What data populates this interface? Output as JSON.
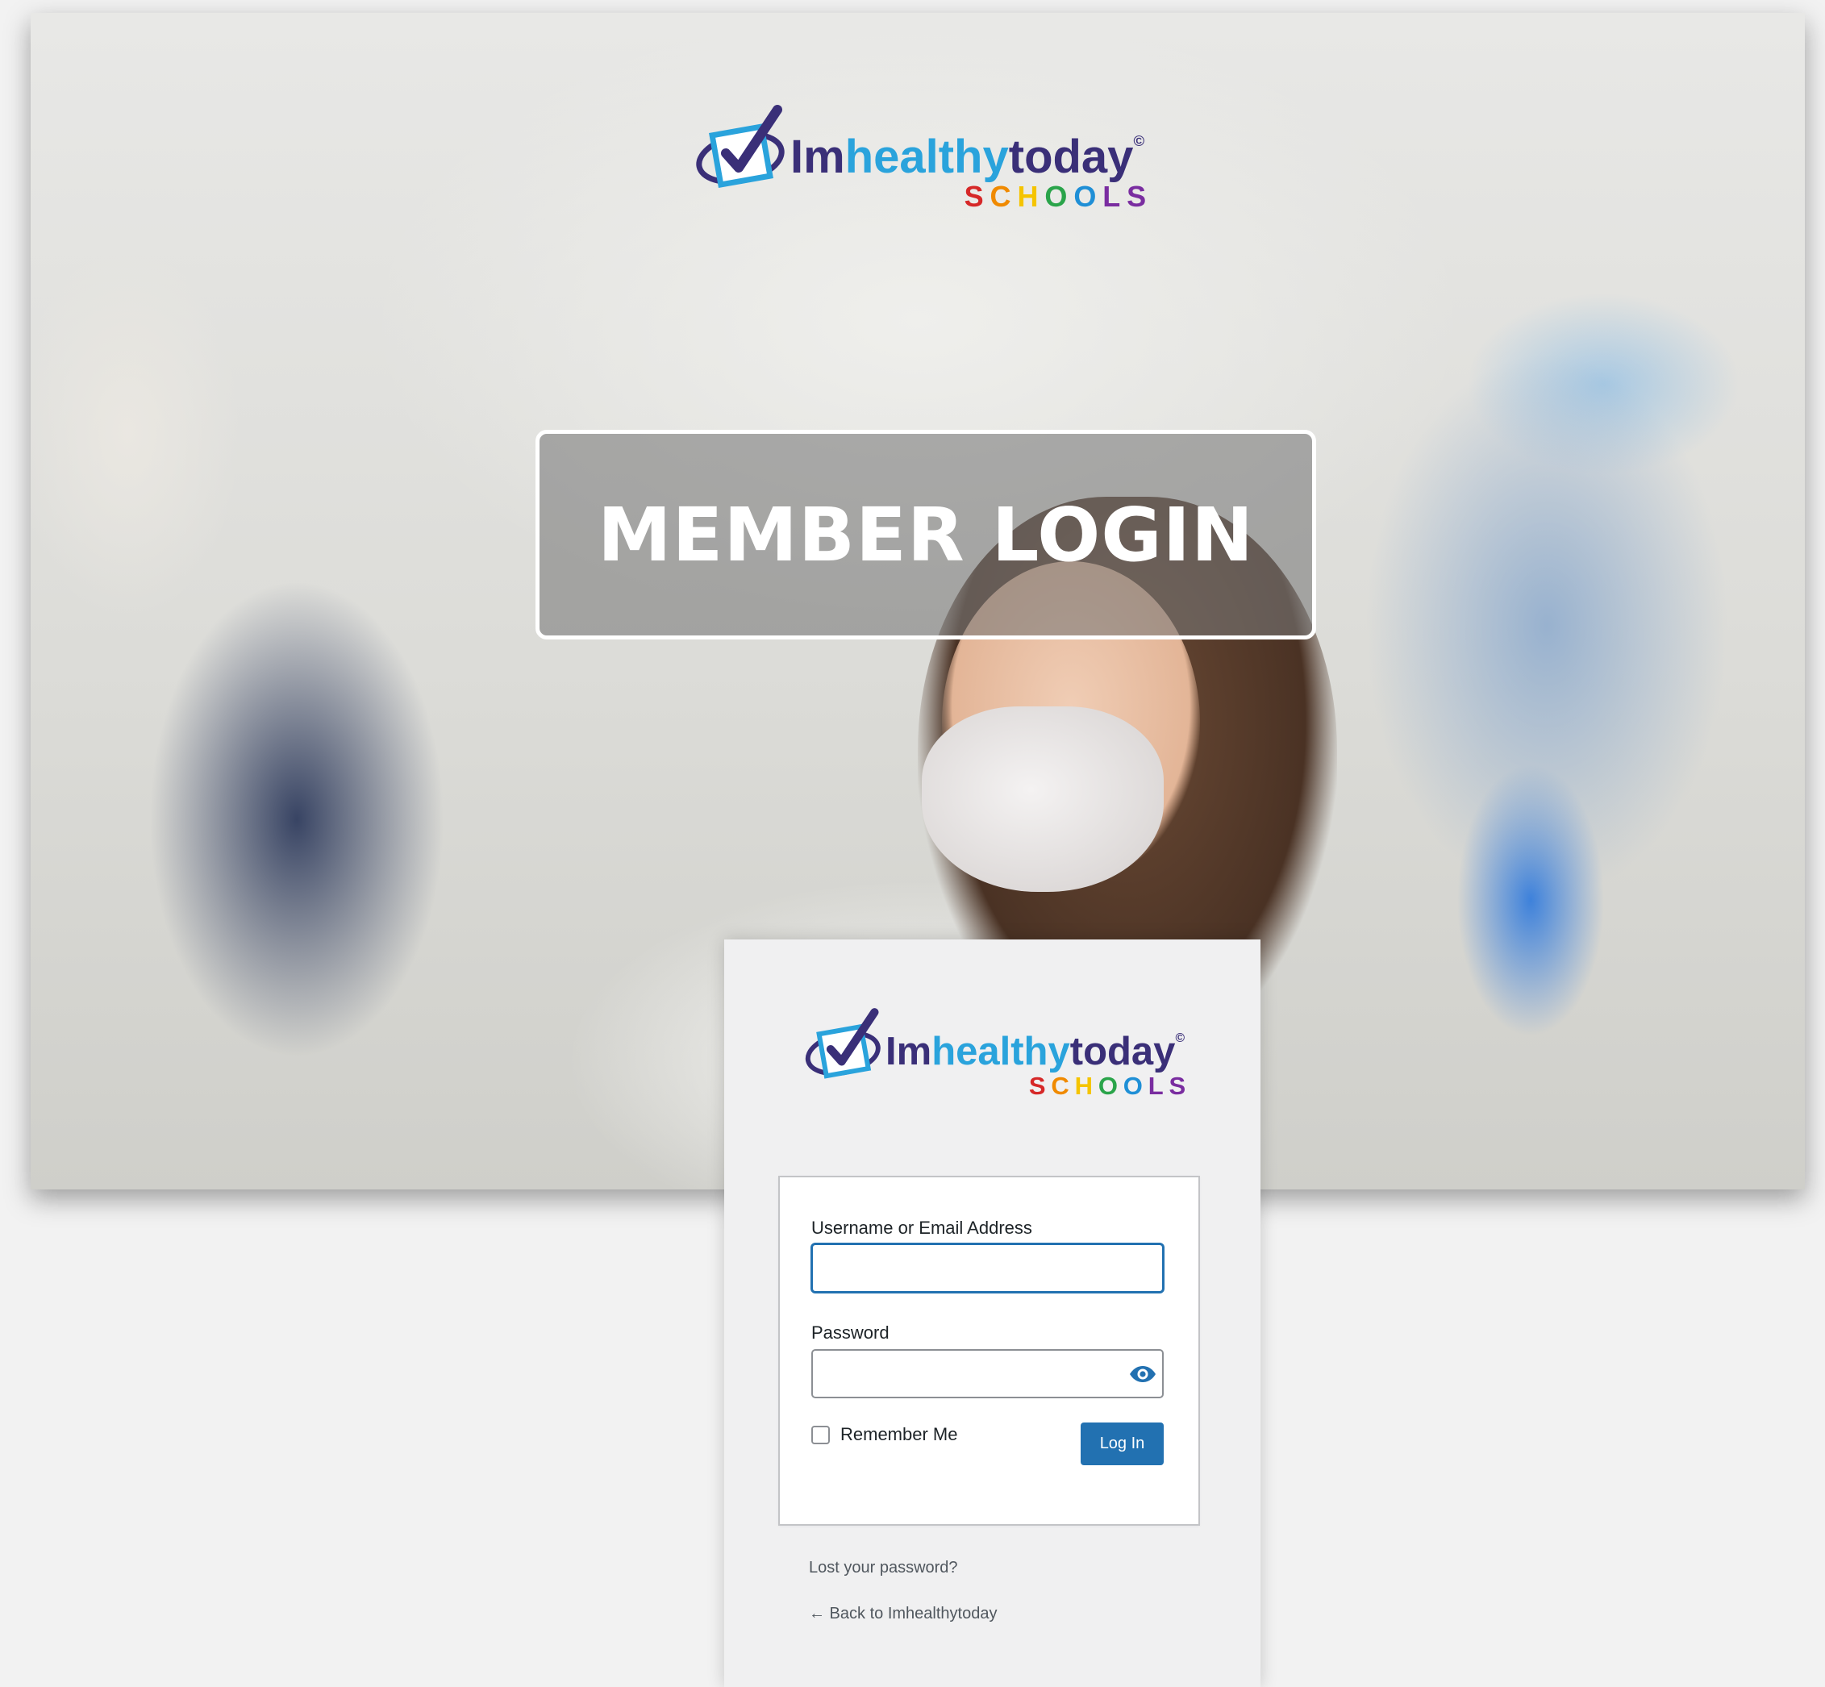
{
  "brand": {
    "im": "Im",
    "healthy": "healthy",
    "today": "today",
    "copyright": "©",
    "schools": [
      "S",
      "C",
      "H",
      "O",
      "O",
      "L",
      "S"
    ]
  },
  "hero": {
    "banner_text": "MEMBER LOGIN"
  },
  "login": {
    "username_label": "Username or Email Address",
    "username_value": "",
    "password_label": "Password",
    "password_value": "",
    "remember_label": "Remember Me",
    "remember_checked": false,
    "submit_label": "Log In"
  },
  "links": {
    "lost_password": "Lost your password?",
    "back_to_site": "← Back to Imhealthytoday"
  },
  "colors": {
    "brand_navy": "#3a2f78",
    "brand_cyan": "#2aa3dc",
    "button_blue": "#2271b1",
    "schools_letters": [
      "#d62828",
      "#f08a00",
      "#f5c400",
      "#2aa44a",
      "#1f8fd6",
      "#7a2da0",
      "#7a2da0"
    ]
  },
  "icons": {
    "logo": "checkmark-box-icon",
    "password_toggle": "eye-icon"
  }
}
